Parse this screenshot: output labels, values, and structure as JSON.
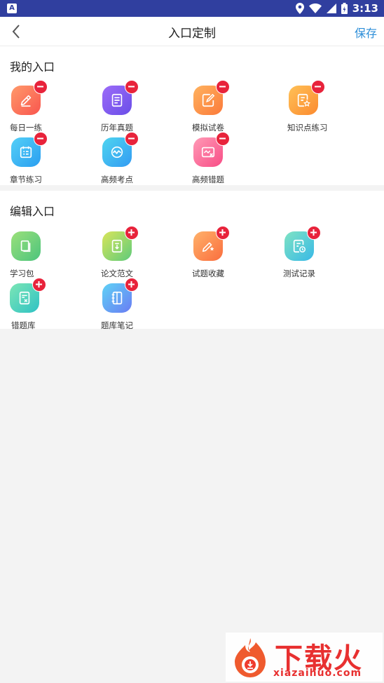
{
  "status_bar": {
    "time": "3:13",
    "left_badge": "A"
  },
  "nav": {
    "title": "入口定制",
    "save_label": "保存"
  },
  "my_entries": {
    "title": "我的入口",
    "items": [
      {
        "label": "每日一练",
        "icon": "pencil-icon",
        "color": "#f9554e"
      },
      {
        "label": "历年真题",
        "icon": "document-icon",
        "color": "#6a4ee8"
      },
      {
        "label": "模拟试卷",
        "icon": "edit-paper-icon",
        "color": "#fb7a3a"
      },
      {
        "label": "知识点练习",
        "icon": "star-document-icon",
        "color": "#fb8a2f"
      },
      {
        "label": "章节练习",
        "icon": "calendar-list-icon",
        "color": "#2a9ef0"
      },
      {
        "label": "高频考点",
        "icon": "wave-circle-icon",
        "color": "#339bf2"
      },
      {
        "label": "高频错题",
        "icon": "chart-x-icon",
        "color": "#f84d86"
      }
    ]
  },
  "edit_entries": {
    "title": "编辑入口",
    "items": [
      {
        "label": "学习包",
        "icon": "book-icon",
        "color": "#4cc47d"
      },
      {
        "label": "论文范文",
        "icon": "download-doc-icon",
        "color": "#5fcb7b"
      },
      {
        "label": "试题收藏",
        "icon": "pencil-star-icon",
        "color": "#fa6e3e"
      },
      {
        "label": "测试记录",
        "icon": "clock-doc-icon",
        "color": "#38b9e7"
      },
      {
        "label": "错题库",
        "icon": "x-doc-icon",
        "color": "#2fc2c4"
      },
      {
        "label": "题库笔记",
        "icon": "notebook-icon",
        "color": "#6a7cf3"
      }
    ]
  },
  "watermark": {
    "text": "下载火",
    "url_text": "xiazaihuo.com"
  }
}
